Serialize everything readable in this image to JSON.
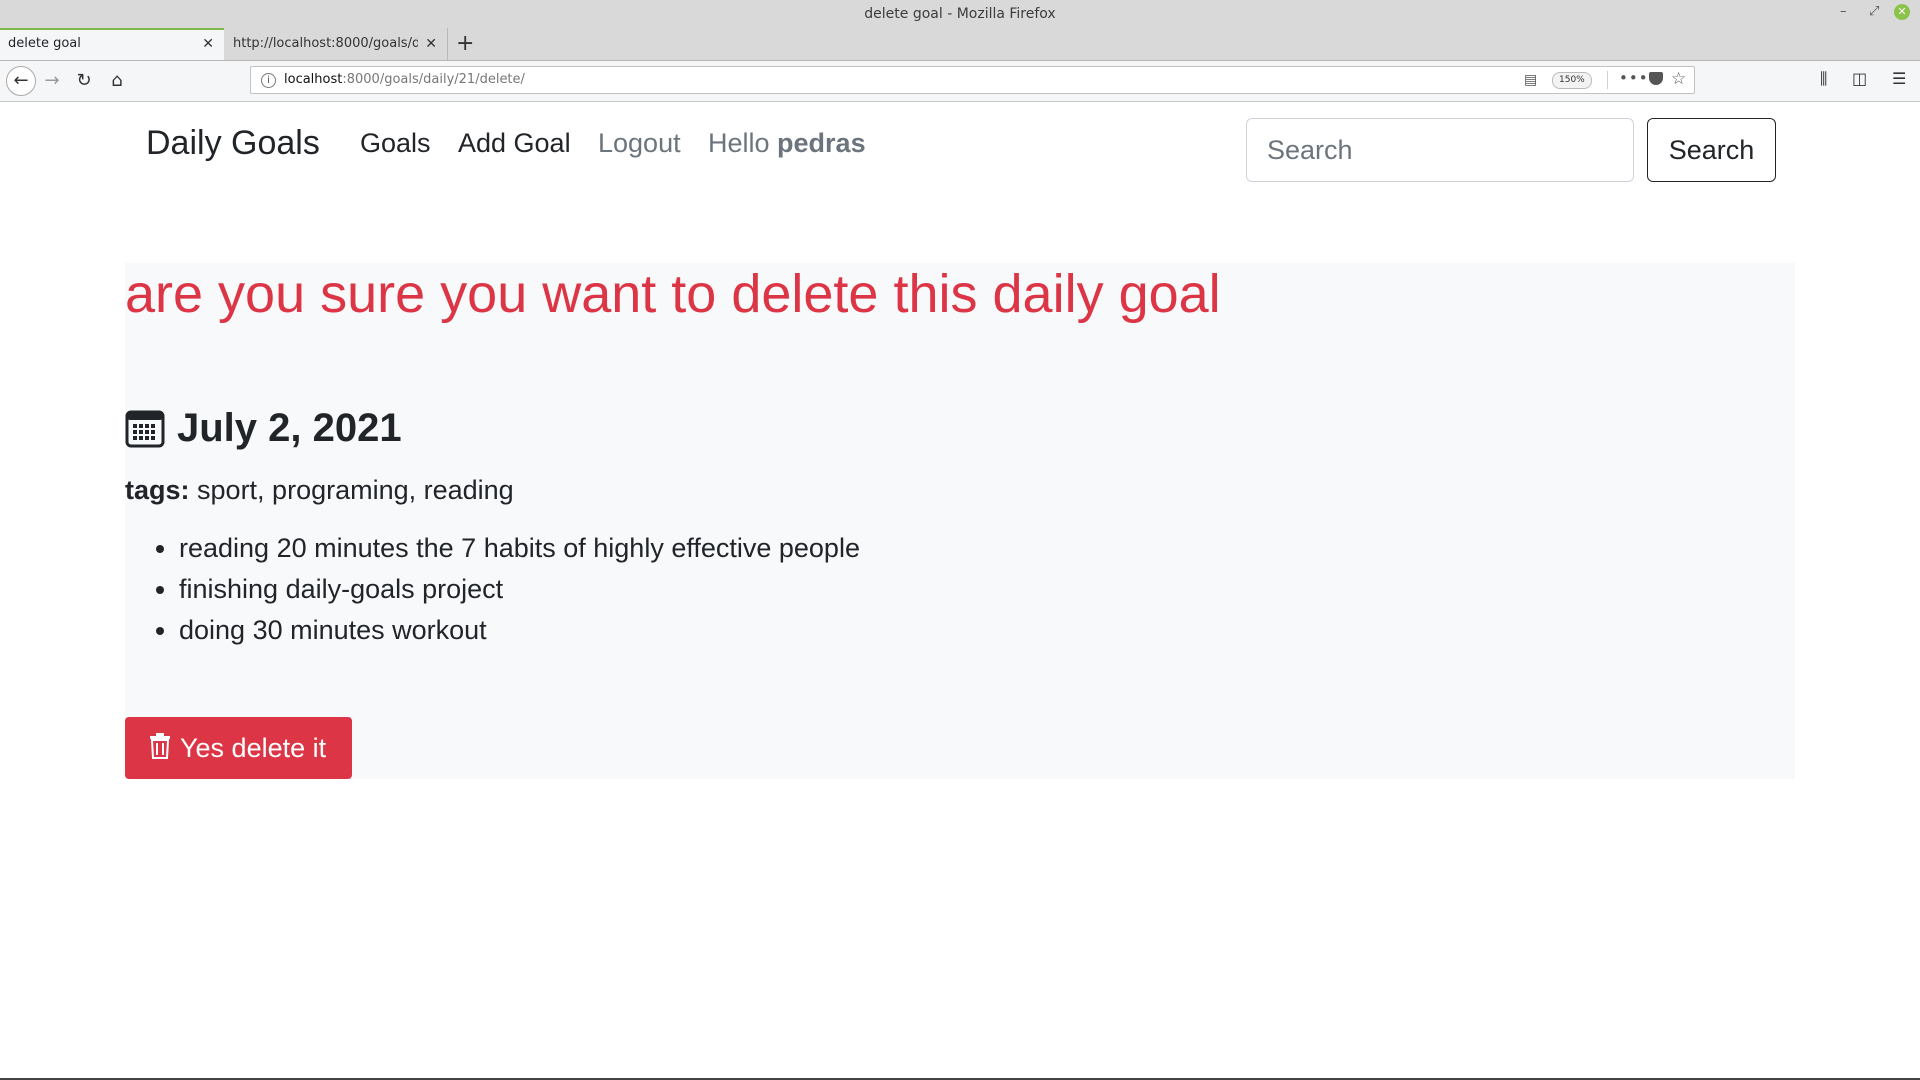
{
  "window": {
    "title": "delete goal - Mozilla Firefox",
    "controls": {
      "minimize": "–",
      "maximize": "⤢",
      "close": "✕"
    }
  },
  "tabs": [
    {
      "label": "delete goal",
      "active": true
    },
    {
      "label": "http://localhost:8000/goals/daily/21/delete/",
      "active": false
    }
  ],
  "browser": {
    "new_tab": "+",
    "url_host": "localhost",
    "url_path": ":8000/goals/daily/21/delete/",
    "zoom": "150%",
    "icons": [
      "back-icon",
      "forward-icon",
      "reload-icon",
      "home-icon",
      "info-icon",
      "reader-view-icon",
      "more-icon",
      "pocket-icon",
      "bookmark-star-icon",
      "library-icon",
      "sidebar-icon",
      "menu-icon"
    ]
  },
  "site": {
    "brand": "Daily Goals",
    "nav": {
      "goals": "Goals",
      "add_goal": "Add Goal",
      "logout": "Logout",
      "hello": "Hello",
      "username": "pedras"
    },
    "search": {
      "placeholder": "Search",
      "button": "Search"
    }
  },
  "main": {
    "heading": "are you sure you want to delete this daily goal",
    "date": "July 2, 2021",
    "tags_label": "tags:",
    "tags": "sport, programing, reading",
    "goals": [
      "reading 20 minutes the 7 habits of highly effective people",
      "finishing daily-goals project",
      "doing 30 minutes workout"
    ],
    "delete_button": "Yes delete it"
  },
  "colors": {
    "danger": "#dc3545",
    "panel_bg": "#f8f9fa",
    "muted": "#6c757d",
    "tab_accent": "#7fb84b"
  }
}
